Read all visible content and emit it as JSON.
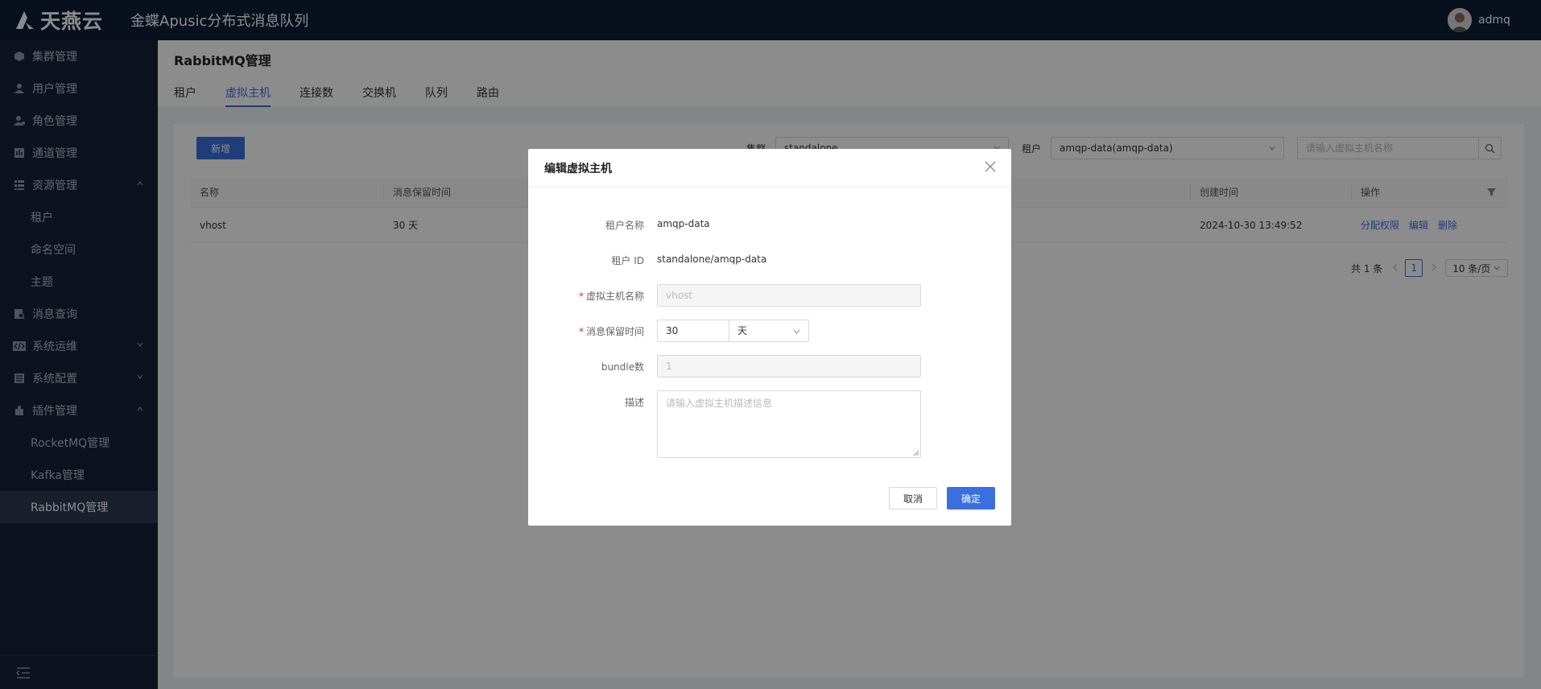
{
  "brand": {
    "logo_text": "天燕云",
    "app_title": "金蝶Apusic分布式消息队列"
  },
  "user": {
    "name": "admq"
  },
  "sidebar": {
    "items": [
      {
        "label": "集群管理",
        "icon": "cube-icon"
      },
      {
        "label": "用户管理",
        "icon": "user-icon"
      },
      {
        "label": "角色管理",
        "icon": "role-icon"
      },
      {
        "label": "通道管理",
        "icon": "channel-icon"
      },
      {
        "label": "资源管理",
        "icon": "resource-icon",
        "expanded": true,
        "children": [
          "租户",
          "命名空间",
          "主题"
        ]
      },
      {
        "label": "消息查询",
        "icon": "message-search-icon"
      },
      {
        "label": "系统运维",
        "icon": "code-icon",
        "expanded": false
      },
      {
        "label": "系统配置",
        "icon": "config-icon",
        "expanded": false
      },
      {
        "label": "插件管理",
        "icon": "plugin-icon",
        "expanded": true,
        "children": [
          "RocketMQ管理",
          "Kafka管理",
          "RabbitMQ管理"
        ]
      }
    ],
    "active": "RabbitMQ管理"
  },
  "page": {
    "title": "RabbitMQ管理",
    "tabs": [
      "租户",
      "虚拟主机",
      "连接数",
      "交换机",
      "队列",
      "路由"
    ],
    "active_tab": "虚拟主机"
  },
  "toolbar": {
    "new_label": "新增",
    "cluster_label": "集群",
    "cluster_value": "standalone",
    "tenant_label": "租户",
    "tenant_value": "amqp-data(amqp-data)",
    "search_placeholder": "请输入虚拟主机名称"
  },
  "table": {
    "columns": [
      "名称",
      "消息保留时间",
      "创建时间",
      "操作"
    ],
    "rows": [
      {
        "name": "vhost",
        "retention": "30 天",
        "created": "2024-10-30 13:49:52",
        "actions": [
          "分配权限",
          "编辑",
          "删除"
        ]
      }
    ]
  },
  "pagination": {
    "total": "共 1 条",
    "current": "1",
    "page_size": "10 条/页"
  },
  "modal": {
    "title": "编辑虚拟主机",
    "fields": {
      "tenant_name_label": "租户名称",
      "tenant_name_value": "amqp-data",
      "tenant_id_label": "租户 ID",
      "tenant_id_value": "standalone/amqp-data",
      "vhost_name_label": "虚拟主机名称",
      "vhost_name_placeholder": "vhost",
      "retention_label": "消息保留时间",
      "retention_value": "30",
      "retention_unit": "天",
      "bundle_label": "bundle数",
      "bundle_value": "1",
      "desc_label": "描述",
      "desc_placeholder": "请输入虚拟主机描述信息"
    },
    "cancel_label": "取消",
    "confirm_label": "确定"
  }
}
